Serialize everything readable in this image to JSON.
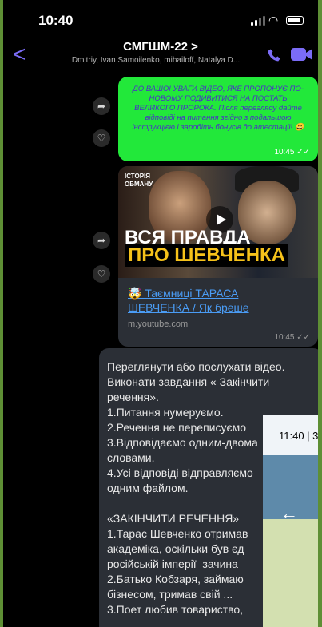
{
  "status": {
    "time": "10:40"
  },
  "header": {
    "back": "<",
    "title": "СМГШМ-22 >",
    "members": "Dmitriy, Ivan Samoilenko, mihailoff, Natalya D..."
  },
  "message1": {
    "text": "ДО ВАШОЇ УВАГИ ВІДЕО, ЯКЕ ПРОПОНУЄ ПО-НОВОМУ ПОДИВИТИСЯ НА ПОСТАТЬ ВЕЛИКОГО ПРОРОКА. Після перегляду дайте відповіді на питання згідно з подальшою інструкцією і заробіть бонусів до атестації! 😀",
    "time": "10:45 ✓✓"
  },
  "message2": {
    "thumb_tag": "ІСТОРІЯ ОБМАНУ",
    "thumb_line1": "ВСЯ ПРАВДА",
    "thumb_line2": "ПРО ШЕВЧЕНКА",
    "link_title": "🤯 Таємниці ТАРАСА ШЕВЧЕНКА / Як бреше",
    "domain": "m.youtube.com",
    "time": "10:45 ✓✓"
  },
  "message3": {
    "text": "Переглянути або послухати відео.\nВиконати завдання « Закінчити речення».\n1.Питання нумеруємо.\n2.Речення не переписуємо\n3.Відповідаємо одним-двома\nсловами.\n4.Усі відповіді відправляємо\nодним файлом.\n\n«ЗАКІНЧИТИ РЕЧЕННЯ»\n1.Тарас Шевченко отримав\nакадеміка, оскільки був єд\nросійській імперії  зачина\n2.Батько Кобзаря, займаю\nбізнесом, тримав свій ...\n3.Поет любив товариство,"
  },
  "overlay": {
    "time": "11:40 | 3",
    "arrow": "←"
  },
  "colors": {
    "accent": "#7b6cf6",
    "bubble_green": "#22e83a",
    "bubble_dark": "#2b2f36"
  }
}
